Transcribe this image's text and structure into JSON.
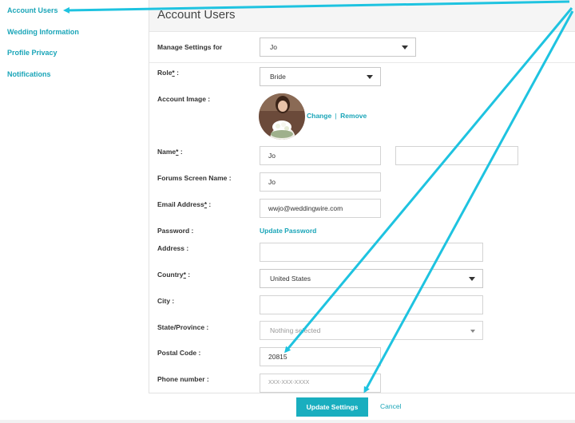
{
  "sidebar": {
    "items": [
      {
        "label": "Account Users"
      },
      {
        "label": "Wedding Information"
      },
      {
        "label": "Profile Privacy"
      },
      {
        "label": "Notifications"
      }
    ]
  },
  "header": {
    "title": "Account Users"
  },
  "form": {
    "manage_settings": {
      "label": "Manage Settings for",
      "value": "Jo"
    },
    "role": {
      "label": "Role",
      "required_mark": "*",
      "suffix": " :",
      "value": "Bride"
    },
    "account_image": {
      "label": "Account Image :",
      "change": "Change",
      "separator": "|",
      "remove": "Remove"
    },
    "name": {
      "label": "Name",
      "required_mark": "*",
      "suffix": " :",
      "first": "Jo",
      "last": ""
    },
    "forums_name": {
      "label": "Forums Screen Name :",
      "value": "Jo"
    },
    "email": {
      "label": "Email Address",
      "required_mark": "*",
      "suffix": " :",
      "value": "wwjo@weddingwire.com"
    },
    "password": {
      "label": "Password :",
      "link": "Update Password"
    },
    "address": {
      "label": "Address :",
      "value": ""
    },
    "country": {
      "label": "Country",
      "required_mark": "*",
      "suffix": " :",
      "value": "United States"
    },
    "city": {
      "label": "City :",
      "value": ""
    },
    "state": {
      "label": "State/Province :",
      "value": "Nothing selected"
    },
    "postal": {
      "label": "Postal Code :",
      "value": "20815"
    },
    "phone": {
      "label": "Phone number :",
      "placeholder": "XXX-XXX-XXXX"
    }
  },
  "footer": {
    "update_label": "Update Settings",
    "cancel_label": "Cancel"
  },
  "colors": {
    "accent": "#1aa5b8",
    "button": "#19aebf",
    "annotation": "#1ec3e0"
  }
}
